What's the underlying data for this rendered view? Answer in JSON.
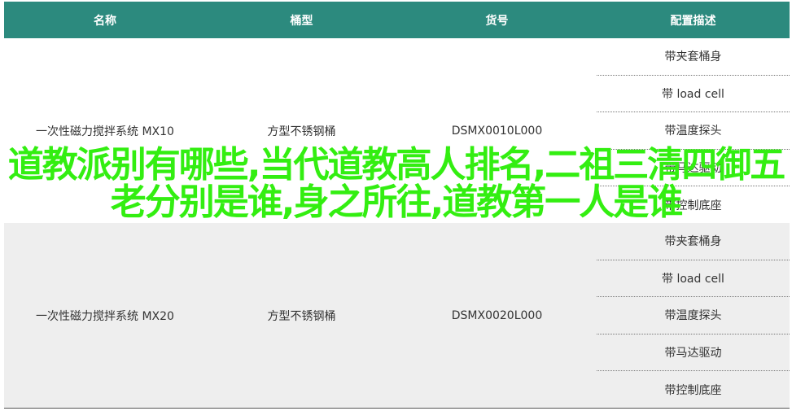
{
  "table": {
    "headers": [
      "名称",
      "桶型",
      "货号",
      "配置描述"
    ],
    "groups": [
      {
        "name": "一次性磁力搅拌系统 MX10",
        "type": "方型不锈钢桶",
        "sku": "DSMX0010L000",
        "configs": [
          "带夹套桶身",
          "带 load cell",
          "带温度探头",
          "带马达驱动",
          "带控制底座"
        ]
      },
      {
        "name": "一次性磁力搅拌系统 MX20",
        "type": "方型不锈钢桶",
        "sku": "DSMX0020L000",
        "configs": [
          "带夹套桶身",
          "带 load cell",
          "带温度探头",
          "带马达驱动",
          "带控制底座"
        ]
      }
    ]
  },
  "overlay": {
    "text": "道教派别有哪些,当代道教高人排名,二祖三清四御五老分别是谁,身之所往,道教第一人是谁"
  },
  "colors": {
    "header_bg": "#2c8a7e",
    "row_alt_bg": "#eeeeee",
    "overlay_text": "#33ee11"
  }
}
